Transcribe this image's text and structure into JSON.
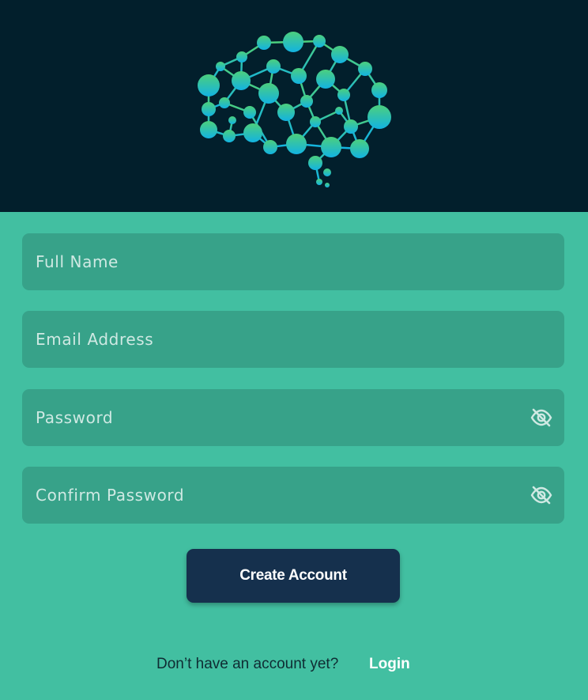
{
  "brand": {
    "logo_icon": "brain-network-icon",
    "header_bg": "#021f2c",
    "logo_gradient": [
      "#4ccf7d",
      "#12b3e2"
    ]
  },
  "form": {
    "background": "#42bfa1",
    "field_bg": "#37a289",
    "full_name": {
      "placeholder": "Full Name"
    },
    "email": {
      "placeholder": "Email Address"
    },
    "password": {
      "placeholder": "Password",
      "toggle_icon": "eye-off-icon"
    },
    "confirm_password": {
      "placeholder": "Confirm Password",
      "toggle_icon": "eye-off-icon"
    },
    "submit_label": "Create Account",
    "submit_bg": "#15304d"
  },
  "footer": {
    "prompt": "Don’t have an account yet?",
    "link_label": "Login"
  }
}
